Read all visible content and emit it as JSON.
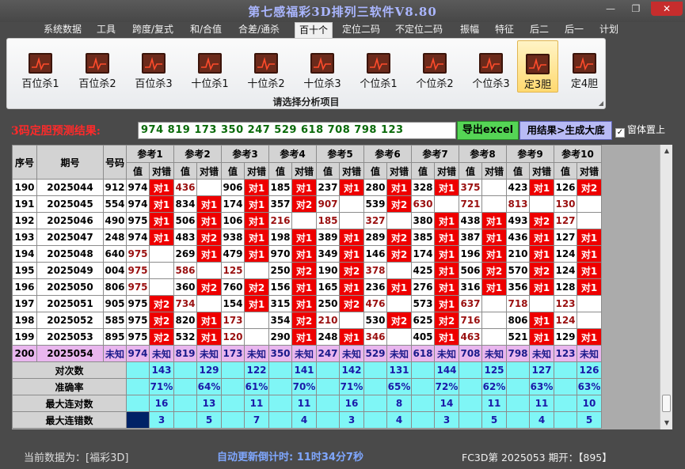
{
  "title": "第七感福彩3D排列三软件V8.80",
  "window_buttons": {
    "min": "—",
    "max": "❐",
    "close": "✕"
  },
  "menu": [
    "系统数据",
    "工具",
    "跨度/复式",
    "和/合值",
    "合差/通杀",
    "百十个",
    "定位二码",
    "不定位二码",
    "振幅",
    "特征",
    "后二",
    "后一",
    "计划"
  ],
  "menu_active": "百十个",
  "ribbon": {
    "buttons": [
      "百位杀1",
      "百位杀2",
      "百位杀3",
      "十位杀1",
      "十位杀2",
      "十位杀3",
      "个位杀1",
      "个位杀2",
      "个位杀3",
      "定3胆",
      "定4胆"
    ],
    "selected": "定3胆",
    "caption": "请选择分析项目"
  },
  "prediction": {
    "label": "3码定胆预测结果:",
    "value": "974 819 173 350 247 529 618 708 798 123",
    "export_label": "导出excel",
    "generate_label": "用结果>生成大底",
    "topmost_label": "窗体置上",
    "topmost_checked": true
  },
  "table": {
    "headers": {
      "index": "序号",
      "period": "期号",
      "number": "号码",
      "val": "值",
      "judge": "对错"
    },
    "refs": [
      "参考1",
      "参考2",
      "参考3",
      "参考4",
      "参考5",
      "参考6",
      "参考7",
      "参考8",
      "参考9",
      "参考10"
    ],
    "rows": [
      {
        "idx": "190",
        "period": "2025044",
        "num": "912",
        "cells": [
          [
            "974",
            "对1"
          ],
          [
            "436",
            ""
          ],
          [
            "906",
            "对1"
          ],
          [
            "185",
            "对1"
          ],
          [
            "237",
            "对1"
          ],
          [
            "280",
            "对1"
          ],
          [
            "328",
            "对1"
          ],
          [
            "375",
            ""
          ],
          [
            "423",
            "对1"
          ],
          [
            "126",
            "对2"
          ]
        ]
      },
      {
        "idx": "191",
        "period": "2025045",
        "num": "554",
        "cells": [
          [
            "974",
            "对1"
          ],
          [
            "834",
            "对1"
          ],
          [
            "174",
            "对1"
          ],
          [
            "357",
            "对2"
          ],
          [
            "907",
            ""
          ],
          [
            "539",
            "对2"
          ],
          [
            "630",
            ""
          ],
          [
            "721",
            ""
          ],
          [
            "813",
            ""
          ],
          [
            "130",
            ""
          ]
        ]
      },
      {
        "idx": "192",
        "period": "2025046",
        "num": "490",
        "cells": [
          [
            "975",
            "对1"
          ],
          [
            "506",
            "对1"
          ],
          [
            "106",
            "对1"
          ],
          [
            "216",
            ""
          ],
          [
            "185",
            ""
          ],
          [
            "327",
            ""
          ],
          [
            "380",
            "对1"
          ],
          [
            "438",
            "对1"
          ],
          [
            "493",
            "对2"
          ],
          [
            "127",
            ""
          ]
        ]
      },
      {
        "idx": "193",
        "period": "2025047",
        "num": "248",
        "cells": [
          [
            "974",
            "对1"
          ],
          [
            "483",
            "对2"
          ],
          [
            "938",
            "对1"
          ],
          [
            "198",
            "对1"
          ],
          [
            "389",
            "对1"
          ],
          [
            "289",
            "对2"
          ],
          [
            "385",
            "对1"
          ],
          [
            "387",
            "对1"
          ],
          [
            "436",
            "对1"
          ],
          [
            "127",
            "对1"
          ]
        ]
      },
      {
        "idx": "194",
        "period": "2025048",
        "num": "640",
        "cells": [
          [
            "975",
            ""
          ],
          [
            "269",
            "对1"
          ],
          [
            "479",
            "对1"
          ],
          [
            "970",
            "对1"
          ],
          [
            "349",
            "对1"
          ],
          [
            "146",
            "对2"
          ],
          [
            "174",
            "对1"
          ],
          [
            "196",
            "对1"
          ],
          [
            "210",
            "对1"
          ],
          [
            "124",
            "对1"
          ]
        ]
      },
      {
        "idx": "195",
        "period": "2025049",
        "num": "004",
        "cells": [
          [
            "975",
            ""
          ],
          [
            "586",
            ""
          ],
          [
            "125",
            ""
          ],
          [
            "250",
            "对2"
          ],
          [
            "190",
            "对2"
          ],
          [
            "378",
            ""
          ],
          [
            "425",
            "对1"
          ],
          [
            "506",
            "对2"
          ],
          [
            "570",
            "对2"
          ],
          [
            "124",
            "对1"
          ]
        ]
      },
      {
        "idx": "196",
        "period": "2025050",
        "num": "806",
        "cells": [
          [
            "975",
            ""
          ],
          [
            "360",
            "对2"
          ],
          [
            "760",
            "对2"
          ],
          [
            "156",
            "对1"
          ],
          [
            "165",
            "对1"
          ],
          [
            "236",
            "对1"
          ],
          [
            "276",
            "对1"
          ],
          [
            "316",
            "对1"
          ],
          [
            "356",
            "对1"
          ],
          [
            "128",
            "对1"
          ]
        ]
      },
      {
        "idx": "197",
        "period": "2025051",
        "num": "905",
        "cells": [
          [
            "975",
            "对2"
          ],
          [
            "734",
            ""
          ],
          [
            "154",
            "对1"
          ],
          [
            "315",
            "对1"
          ],
          [
            "250",
            "对2"
          ],
          [
            "476",
            ""
          ],
          [
            "573",
            "对1"
          ],
          [
            "637",
            ""
          ],
          [
            "718",
            ""
          ],
          [
            "123",
            ""
          ]
        ]
      },
      {
        "idx": "198",
        "period": "2025052",
        "num": "585",
        "cells": [
          [
            "975",
            "对2"
          ],
          [
            "820",
            "对1"
          ],
          [
            "173",
            ""
          ],
          [
            "354",
            "对2"
          ],
          [
            "210",
            ""
          ],
          [
            "530",
            "对2"
          ],
          [
            "625",
            "对2"
          ],
          [
            "716",
            ""
          ],
          [
            "806",
            "对1"
          ],
          [
            "124",
            ""
          ]
        ]
      },
      {
        "idx": "199",
        "period": "2025053",
        "num": "895",
        "cells": [
          [
            "975",
            "对2"
          ],
          [
            "532",
            "对1"
          ],
          [
            "120",
            ""
          ],
          [
            "290",
            "对1"
          ],
          [
            "248",
            "对1"
          ],
          [
            "346",
            ""
          ],
          [
            "405",
            "对1"
          ],
          [
            "463",
            ""
          ],
          [
            "521",
            "对1"
          ],
          [
            "129",
            "对1"
          ]
        ]
      }
    ],
    "next": {
      "idx": "200",
      "period": "2025054",
      "num": "未知",
      "cells": [
        "974",
        "819",
        "173",
        "350",
        "247",
        "529",
        "618",
        "708",
        "798",
        "123"
      ],
      "unknown": "未知"
    },
    "stats": [
      {
        "label": "对次数",
        "values": [
          "143",
          "129",
          "122",
          "141",
          "142",
          "131",
          "144",
          "125",
          "127",
          "126"
        ]
      },
      {
        "label": "准确率",
        "values": [
          "71%",
          "64%",
          "61%",
          "70%",
          "71%",
          "65%",
          "72%",
          "62%",
          "63%",
          "63%"
        ]
      },
      {
        "label": "最大连对数",
        "values": [
          "16",
          "13",
          "11",
          "11",
          "16",
          "8",
          "14",
          "11",
          "11",
          "10"
        ]
      },
      {
        "label": "最大连错数",
        "values": [
          "3",
          "5",
          "7",
          "4",
          "3",
          "4",
          "3",
          "5",
          "4",
          "5"
        ]
      }
    ]
  },
  "status": {
    "current_data": "当前数据为：[福彩3D]",
    "countdown": "自动更新倒计时:  11时34分7秒",
    "latest": "FC3D第 2025053 期开：【895】"
  }
}
